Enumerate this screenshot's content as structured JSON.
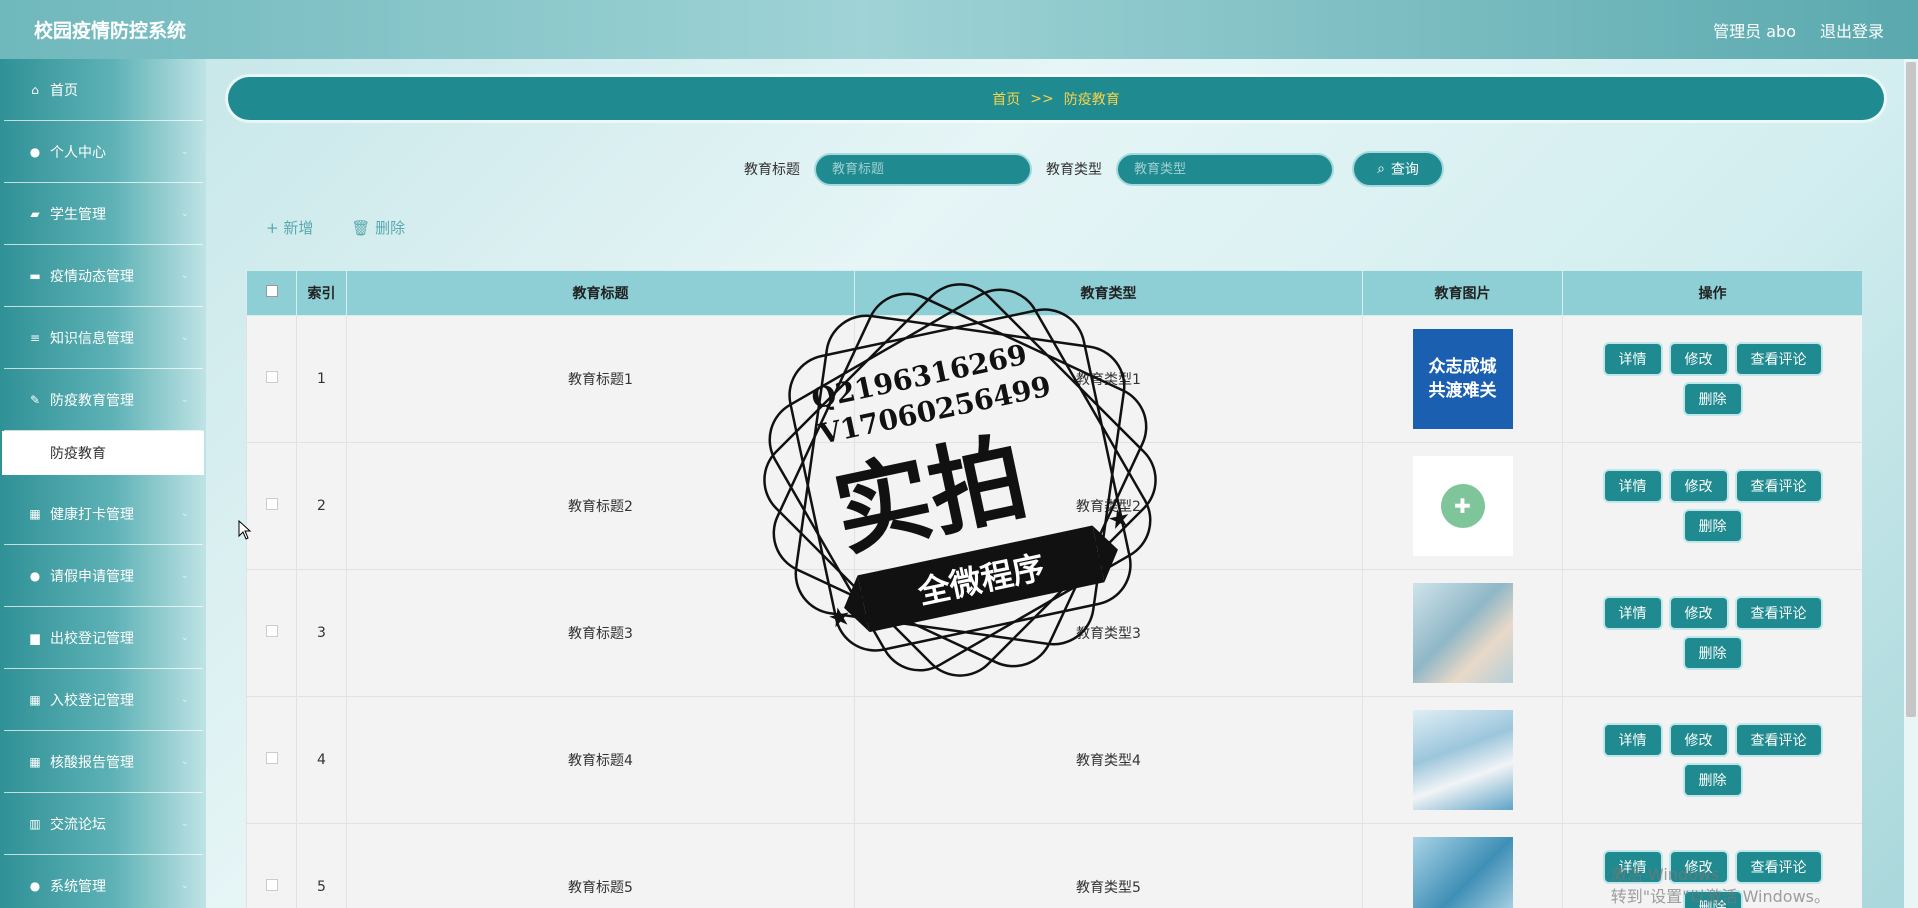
{
  "app": {
    "title": "校园疫情防控系统"
  },
  "header": {
    "admin": "管理员 abo",
    "logout": "退出登录"
  },
  "sidebar": {
    "items": [
      {
        "label": "首页",
        "icon": "home-icon",
        "glyph": "⌂",
        "chevron": false
      },
      {
        "label": "个人中心",
        "icon": "user-icon",
        "glyph": "●",
        "chevron": true
      },
      {
        "label": "学生管理",
        "icon": "students-icon",
        "glyph": "▰",
        "chevron": true
      },
      {
        "label": "疫情动态管理",
        "icon": "monitor-icon",
        "glyph": "▬",
        "chevron": true
      },
      {
        "label": "知识信息管理",
        "icon": "list-icon",
        "glyph": "≡",
        "chevron": true
      },
      {
        "label": "防疫教育管理",
        "icon": "edit-icon",
        "glyph": "✎",
        "chevron": true,
        "expanded": true,
        "sub": "防疫教育"
      },
      {
        "label": "健康打卡管理",
        "icon": "grid-icon",
        "glyph": "▦",
        "chevron": true
      },
      {
        "label": "请假申请管理",
        "icon": "person-icon",
        "glyph": "●",
        "chevron": true
      },
      {
        "label": "出校登记管理",
        "icon": "comment-icon",
        "glyph": "▆",
        "chevron": true
      },
      {
        "label": "入校登记管理",
        "icon": "grid-icon",
        "glyph": "▦",
        "chevron": true
      },
      {
        "label": "核酸报告管理",
        "icon": "grid-icon",
        "glyph": "▦",
        "chevron": true
      },
      {
        "label": "交流论坛",
        "icon": "chart-icon",
        "glyph": "▥",
        "chevron": true
      },
      {
        "label": "系统管理",
        "icon": "location-icon",
        "glyph": "●",
        "chevron": true
      }
    ]
  },
  "breadcrumb": {
    "home": "首页",
    "sep": ">>",
    "current": "防疫教育"
  },
  "search": {
    "title_label": "教育标题",
    "title_placeholder": "教育标题",
    "type_label": "教育类型",
    "type_placeholder": "教育类型",
    "button": "查询"
  },
  "toolbar": {
    "add": "+ 新增",
    "delete": "删除"
  },
  "table": {
    "headers": [
      "索引",
      "教育标题",
      "教育类型",
      "教育图片",
      "操作"
    ],
    "rows": [
      {
        "index": "1",
        "title": "教育标题1",
        "type": "教育类型1",
        "image": "众志成城 共渡难关"
      },
      {
        "index": "2",
        "title": "教育标题2",
        "type": "教育类型2",
        "image": ""
      },
      {
        "index": "3",
        "title": "教育标题3",
        "type": "教育类型3",
        "image": ""
      },
      {
        "index": "4",
        "title": "教育标题4",
        "type": "教育类型4",
        "image": ""
      },
      {
        "index": "5",
        "title": "教育标题5",
        "type": "教育类型5",
        "image": ""
      }
    ],
    "ops": {
      "detail": "详情",
      "edit": "修改",
      "comments": "查看评论",
      "delete": "删除"
    }
  },
  "watermark": {
    "line1": "Q2196316269",
    "line2": "V17060256499",
    "big": "实拍",
    "ribbon": "全微程序"
  },
  "windows": {
    "line1": "激活 Windows",
    "line2": "转到\"设置\"以激活 Windows。"
  },
  "colors": {
    "accent": "#1f8a8f",
    "breadcrumb_text": "#f7d44a",
    "header_row": "#8ecfd6"
  }
}
